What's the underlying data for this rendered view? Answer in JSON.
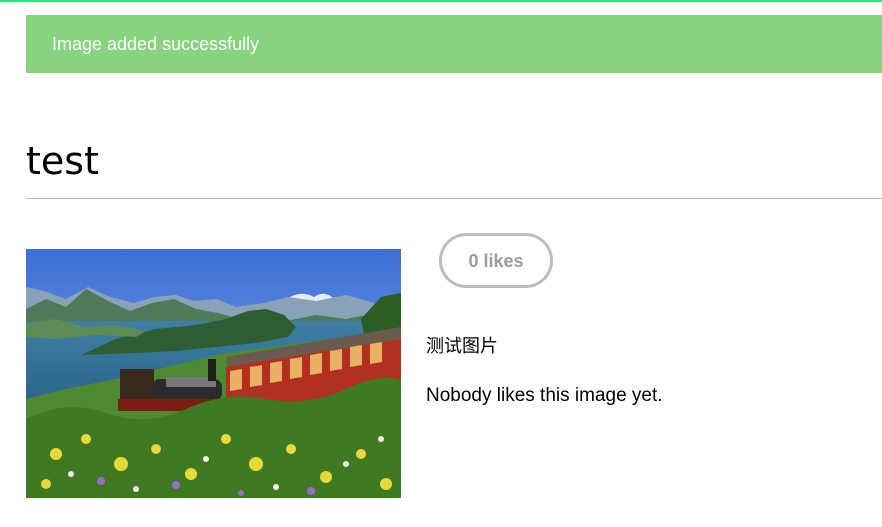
{
  "flash": {
    "message": "Image added successfully",
    "color": "#87d37e"
  },
  "image": {
    "title": "test",
    "description": "测试图片",
    "likes_label": "0 likes",
    "likes_count": 0,
    "likes_status": "Nobody likes this image yet."
  },
  "colors": {
    "top_strip": "#2ee37a",
    "likes_border": "#bdbdbd",
    "likes_text": "#9b9b9b"
  }
}
